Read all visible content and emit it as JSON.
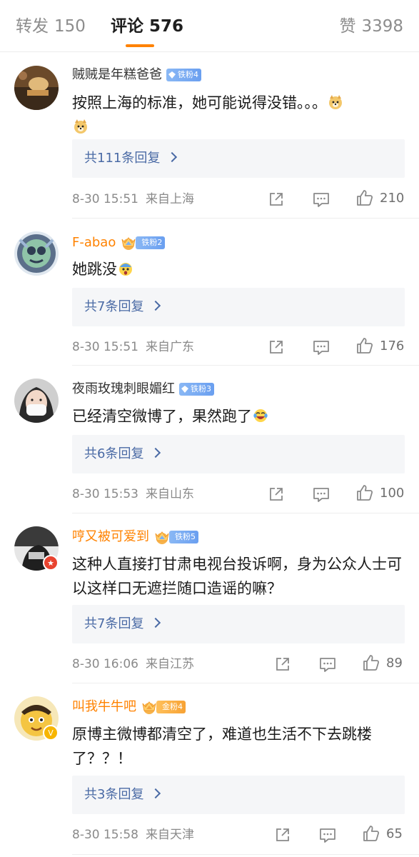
{
  "tabs": {
    "repost": {
      "label": "转发",
      "count": "150"
    },
    "comment": {
      "label": "评论",
      "count": "576"
    },
    "like": {
      "label": "赞",
      "count": "3398"
    }
  },
  "colors": {
    "accent": "#ff8200",
    "link": "#4a6aa5",
    "fan_blue": "#79acf2",
    "fan_gold": "#f7a234"
  },
  "comments": [
    {
      "username": "贼贼是年糕爸爸",
      "fan_badge": "铁粉4",
      "text": "按照上海的标准，她可能说得没错。。。",
      "emoji": [
        "doge-emoji",
        "doge-emoji"
      ],
      "replies": "共111条回复",
      "time": "8-30 15:51",
      "location": "来自上海",
      "likes": "210"
    },
    {
      "username": "F-abao",
      "fan_badge": "铁粉2",
      "text": "她跳没",
      "emoji": [
        "shocked-emoji"
      ],
      "replies": "共7条回复",
      "time": "8-30 15:51",
      "location": "来自广东",
      "likes": "176"
    },
    {
      "username": "夜雨玫瑰刺眼媚红",
      "fan_badge": "铁粉3",
      "text": "已经清空微博了，果然跑了",
      "emoji": [
        "laugh-cry-emoji"
      ],
      "replies": "共6条回复",
      "time": "8-30 15:53",
      "location": "来自山东",
      "likes": "100"
    },
    {
      "username": "哼又被可爱到",
      "fan_badge": "铁粉5",
      "text": "这种人直接打甘肃电视台投诉啊，身为公众人士可以这样口无遮拦随口造谣的嘛？",
      "replies": "共7条回复",
      "time": "8-30 16:06",
      "location": "来自江苏",
      "likes": "89"
    },
    {
      "username": "叫我牛牛吧",
      "fan_badge": "金粉4",
      "text": "原博主微博都清空了，难道也生活不下去跳楼了？？！",
      "replies": "共3条回复",
      "time": "8-30 15:58",
      "location": "来自天津",
      "likes": "65"
    }
  ]
}
